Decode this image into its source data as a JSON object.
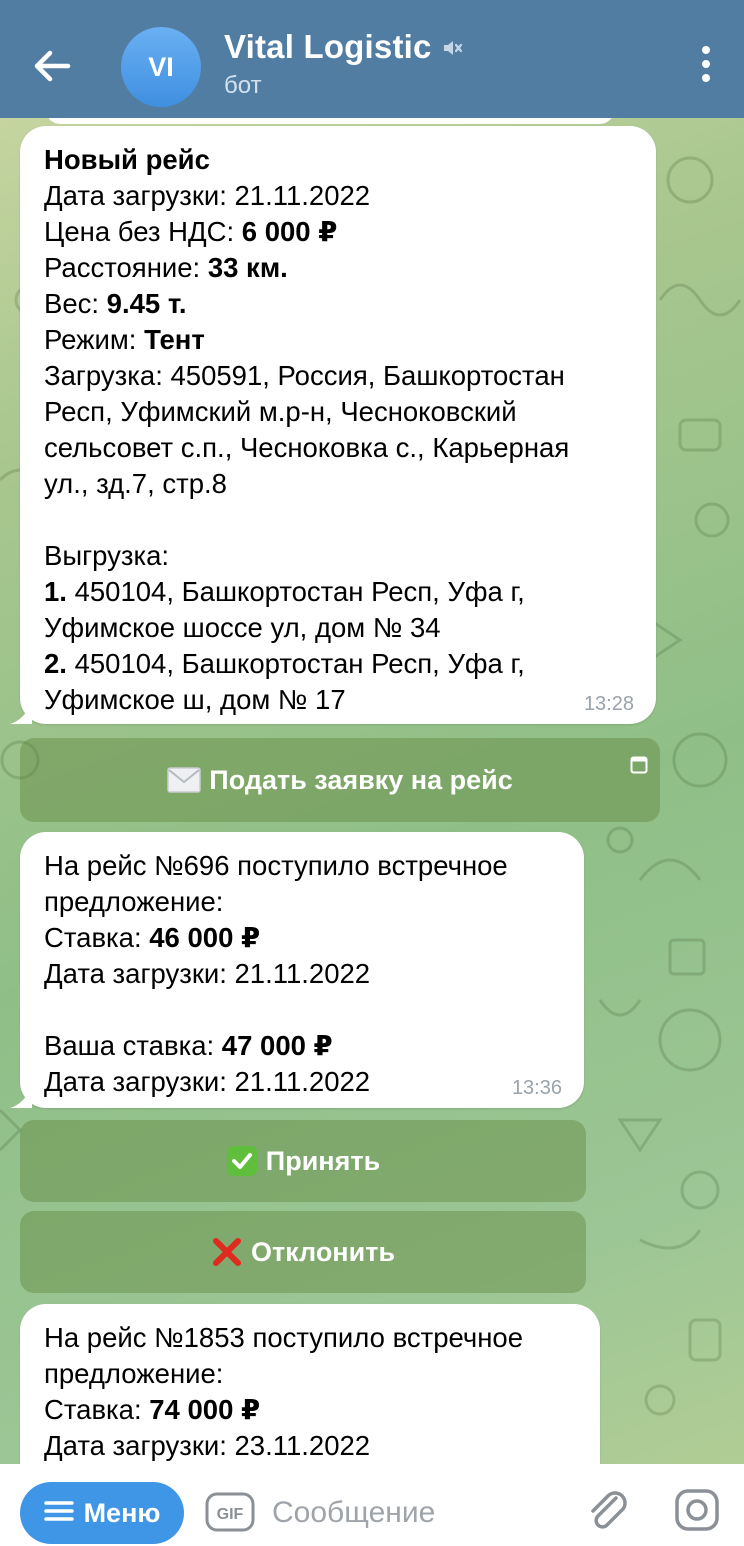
{
  "header": {
    "avatar_initials": "VI",
    "title": "Vital Logistic",
    "subtitle": "бот",
    "accent_color": "#527da3"
  },
  "message1": {
    "title": "Новый рейс",
    "load_date_label": "Дата загрузки: ",
    "load_date": "21.11.2022",
    "price_label": "Цена без НДС: ",
    "price": "6 000 ₽",
    "distance_label": "Расстояние: ",
    "distance": "33 км.",
    "weight_label": "Вес: ",
    "weight": "9.45 т.",
    "mode_label": "Режим: ",
    "mode": "Тент",
    "loading_lines": [
      "Загрузка: 450591, Россия, Башкортостан",
      "Респ, Уфимский м.р-н, Чесноковский",
      "сельсовет с.п., Чесноковка с., Карьерная",
      "ул., зд.7, стр.8"
    ],
    "unloading_label": "Выгрузка:",
    "unload1_num": "1.",
    "unload1_a": " 450104, Башкортостан Респ, Уфа г,",
    "unload1_b": "Уфимское шоссе ул, дом № 34",
    "unload2_num": "2.",
    "unload2_a": " 450104, Башкортостан Респ, Уфа г,",
    "unload2_b": "Уфимское ш, дом № 17",
    "time": "13:28"
  },
  "apply_button": {
    "icon": "envelope-icon",
    "label": "Подать заявку на рейс"
  },
  "message2": {
    "line1": "На рейс №696 поступило встречное",
    "line2": "предложение:",
    "rate_label": "Ставка: ",
    "rate": "46 000 ₽",
    "date_label": "Дата загрузки: ",
    "date": "21.11.2022",
    "your_rate_label": "Ваша ставка: ",
    "your_rate": "47 000 ₽",
    "your_date_label": "Дата загрузки: ",
    "your_date": "21.11.2022",
    "time": "13:36"
  },
  "accept_button": {
    "icon": "check-mark-icon",
    "label": "Принять"
  },
  "decline_button": {
    "icon": "cross-mark-icon",
    "label": "Отклонить"
  },
  "message3": {
    "line1": "На рейс №1853 поступило встречное",
    "line2": "предложение:",
    "rate_label": "Ставка: ",
    "rate": "74 000 ₽",
    "date_label": "Дата загрузки: ",
    "date": "23.11.2022"
  },
  "input_bar": {
    "menu_label": "Меню",
    "gif_label": "GIF",
    "placeholder": "Сообщение",
    "menu_color": "#3f96e6"
  }
}
